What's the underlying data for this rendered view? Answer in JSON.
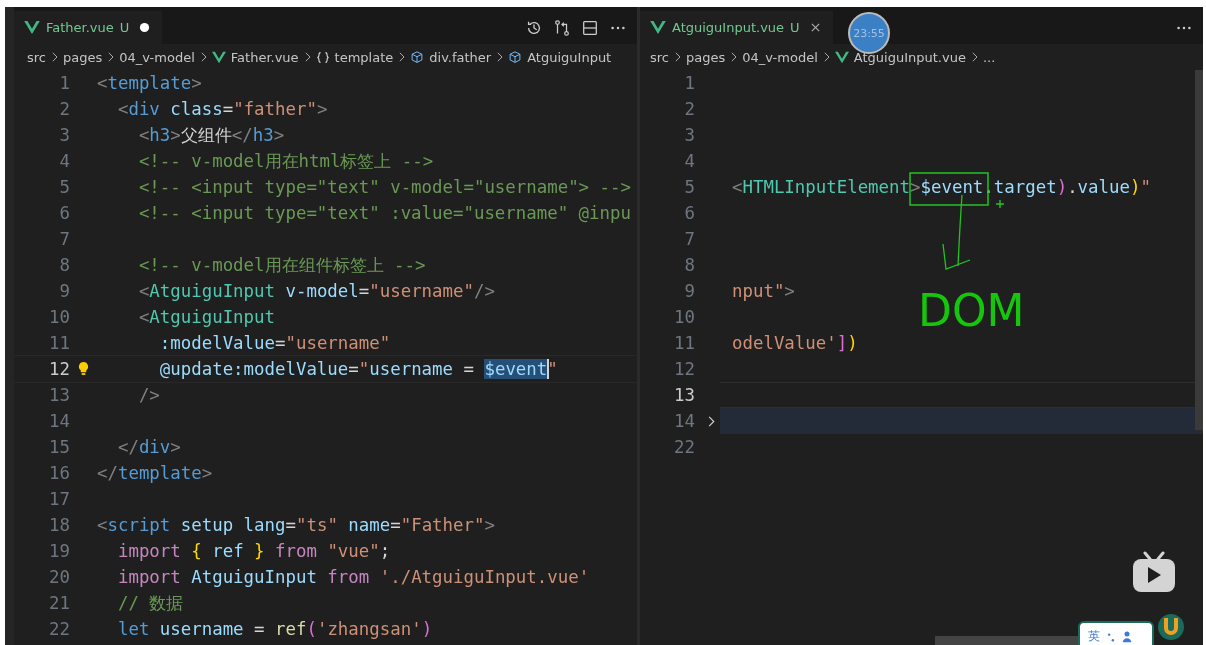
{
  "left_pane": {
    "tab": {
      "name": "Father.vue",
      "status": "U",
      "dirty": true
    },
    "breadcrumb": [
      {
        "text": "src",
        "kind": "folder"
      },
      {
        "text": "pages",
        "kind": "folder"
      },
      {
        "text": "04_v-model",
        "kind": "folder"
      },
      {
        "text": "Father.vue",
        "kind": "vue"
      },
      {
        "text": "template",
        "kind": "braces"
      },
      {
        "text": "div.father",
        "kind": "element"
      },
      {
        "text": "AtguiguInput",
        "kind": "element"
      }
    ],
    "lines": [
      {
        "n": "1",
        "current": false,
        "lightbulb": false,
        "tokens": [
          {
            "t": "<",
            "kind": "punct"
          },
          {
            "t": "template",
            "kind": "tag"
          },
          {
            "t": ">",
            "kind": "punct"
          }
        ]
      },
      {
        "n": "2",
        "current": false,
        "lightbulb": false,
        "tokens": [
          {
            "t": "  <",
            "kind": "punct"
          },
          {
            "t": "div",
            "kind": "tag"
          },
          {
            "t": " class",
            "kind": "attr"
          },
          {
            "t": "=",
            "kind": "plain"
          },
          {
            "t": "\"father\"",
            "kind": "string"
          },
          {
            "t": ">",
            "kind": "punct"
          }
        ]
      },
      {
        "n": "3",
        "current": false,
        "lightbulb": false,
        "tokens": [
          {
            "t": "    <",
            "kind": "punct"
          },
          {
            "t": "h3",
            "kind": "tag"
          },
          {
            "t": ">",
            "kind": "punct"
          },
          {
            "t": "父组件",
            "kind": "plain"
          },
          {
            "t": "</",
            "kind": "punct"
          },
          {
            "t": "h3",
            "kind": "tag"
          },
          {
            "t": ">",
            "kind": "punct"
          }
        ]
      },
      {
        "n": "4",
        "current": false,
        "lightbulb": false,
        "tokens": [
          {
            "t": "    <!-- v-model用在html标签上 -->",
            "kind": "comment"
          }
        ]
      },
      {
        "n": "5",
        "current": false,
        "lightbulb": false,
        "tokens": [
          {
            "t": "    <!-- <input type=\"text\" v-model=\"username\"> -->",
            "kind": "comment"
          }
        ]
      },
      {
        "n": "6",
        "current": false,
        "lightbulb": false,
        "tokens": [
          {
            "t": "    <!-- <input type=\"text\" :value=\"username\" @inpu",
            "kind": "comment"
          }
        ]
      },
      {
        "n": "7",
        "current": false,
        "lightbulb": false
      },
      {
        "n": "8",
        "current": false,
        "lightbulb": false,
        "tokens": [
          {
            "t": "    <!-- v-model用在组件标签上 -->",
            "kind": "comment"
          }
        ]
      },
      {
        "n": "9",
        "current": false,
        "lightbulb": false,
        "tokens": [
          {
            "t": "    <",
            "kind": "punct"
          },
          {
            "t": "AtguiguInput",
            "kind": "type"
          },
          {
            "t": " v-model",
            "kind": "attr"
          },
          {
            "t": "=",
            "kind": "plain"
          },
          {
            "t": "\"username\"",
            "kind": "string"
          },
          {
            "t": "/>",
            "kind": "punct"
          }
        ]
      },
      {
        "n": "10",
        "current": false,
        "lightbulb": false,
        "tokens": [
          {
            "t": "    <",
            "kind": "punct"
          },
          {
            "t": "AtguiguInput",
            "kind": "type"
          }
        ]
      },
      {
        "n": "11",
        "current": false,
        "lightbulb": false,
        "tokens": [
          {
            "t": "      :modelValue",
            "kind": "attr"
          },
          {
            "t": "=",
            "kind": "plain"
          },
          {
            "t": "\"username\"",
            "kind": "string"
          }
        ]
      },
      {
        "n": "12",
        "current": true,
        "lightbulb": true,
        "tokens": [
          {
            "t": "      @update:modelValue",
            "kind": "attr"
          },
          {
            "t": "=",
            "kind": "plain"
          },
          {
            "t": "\"",
            "kind": "string"
          },
          {
            "t": "username",
            "kind": "variable"
          },
          {
            "t": " = ",
            "kind": "plain"
          },
          {
            "t": "$event",
            "kind": "variable",
            "selected": true
          },
          {
            "t": "\"",
            "kind": "string"
          }
        ]
      },
      {
        "n": "13",
        "current": false,
        "lightbulb": false,
        "tokens": [
          {
            "t": "    />",
            "kind": "punct"
          }
        ]
      },
      {
        "n": "14",
        "current": false,
        "lightbulb": false
      },
      {
        "n": "15",
        "current": false,
        "lightbulb": false,
        "tokens": [
          {
            "t": "  </",
            "kind": "punct"
          },
          {
            "t": "div",
            "kind": "tag"
          },
          {
            "t": ">",
            "kind": "punct"
          }
        ]
      },
      {
        "n": "16",
        "current": false,
        "lightbulb": false,
        "tokens": [
          {
            "t": "</",
            "kind": "punct"
          },
          {
            "t": "template",
            "kind": "tag"
          },
          {
            "t": ">",
            "kind": "punct"
          }
        ]
      },
      {
        "n": "17",
        "current": false,
        "lightbulb": false
      },
      {
        "n": "18",
        "current": false,
        "lightbulb": false,
        "tokens": [
          {
            "t": "<",
            "kind": "punct"
          },
          {
            "t": "script",
            "kind": "tag"
          },
          {
            "t": " setup lang",
            "kind": "attr"
          },
          {
            "t": "=",
            "kind": "plain"
          },
          {
            "t": "\"ts\"",
            "kind": "string"
          },
          {
            "t": " name",
            "kind": "attr"
          },
          {
            "t": "=",
            "kind": "plain"
          },
          {
            "t": "\"Father\"",
            "kind": "string"
          },
          {
            "t": ">",
            "kind": "punct"
          }
        ]
      },
      {
        "n": "19",
        "current": false,
        "lightbulb": false,
        "tokens": [
          {
            "t": "  import",
            "kind": "control"
          },
          {
            "t": " {",
            "kind": "bracket"
          },
          {
            "t": " ref",
            "kind": "variable"
          },
          {
            "t": " }",
            "kind": "bracket"
          },
          {
            "t": " from",
            "kind": "control"
          },
          {
            "t": " \"vue\"",
            "kind": "string"
          },
          {
            "t": ";",
            "kind": "plain"
          }
        ]
      },
      {
        "n": "20",
        "current": false,
        "lightbulb": false,
        "tokens": [
          {
            "t": "  import",
            "kind": "control"
          },
          {
            "t": " AtguiguInput",
            "kind": "variable"
          },
          {
            "t": " from",
            "kind": "control"
          },
          {
            "t": " './AtguiguInput.vue'",
            "kind": "string"
          }
        ]
      },
      {
        "n": "21",
        "current": false,
        "lightbulb": false,
        "tokens": [
          {
            "t": "  // 数据",
            "kind": "comment"
          }
        ]
      },
      {
        "n": "22",
        "current": false,
        "lightbulb": false,
        "tokens": [
          {
            "t": "  let",
            "kind": "keyword"
          },
          {
            "t": " username",
            "kind": "variable"
          },
          {
            "t": " = ",
            "kind": "plain"
          },
          {
            "t": "ref",
            "kind": "function"
          },
          {
            "t": "(",
            "kind": "paren"
          },
          {
            "t": "'zhangsan'",
            "kind": "string"
          },
          {
            "t": ")",
            "kind": "paren"
          }
        ]
      }
    ]
  },
  "right_pane": {
    "tab": {
      "name": "AtguiguInput.vue",
      "status": "U",
      "dirty": false
    },
    "breadcrumb": [
      {
        "text": "src",
        "kind": "folder"
      },
      {
        "text": "pages",
        "kind": "folder"
      },
      {
        "text": "04_v-model",
        "kind": "folder"
      },
      {
        "text": "AtguiguInput.vue",
        "kind": "vue"
      },
      {
        "text": "...",
        "kind": "more"
      }
    ],
    "lines": [
      {
        "n": "1",
        "current": false,
        "folded": false
      },
      {
        "n": "2",
        "current": false,
        "folded": false
      },
      {
        "n": "3",
        "current": false,
        "folded": false
      },
      {
        "n": "4",
        "current": false,
        "folded": false
      },
      {
        "n": "5",
        "current": false,
        "folded": false,
        "tokens": [
          {
            "t": "<",
            "kind": "punct"
          },
          {
            "t": "HTMLInputElement",
            "kind": "type"
          },
          {
            "t": ">",
            "kind": "punct"
          },
          {
            "t": "$event",
            "kind": "variable"
          },
          {
            "t": ".",
            "kind": "plain"
          },
          {
            "t": "target",
            "kind": "variable"
          },
          {
            "t": ")",
            "kind": "paren"
          },
          {
            "t": ".",
            "kind": "plain"
          },
          {
            "t": "value",
            "kind": "variable"
          },
          {
            "t": ")",
            "kind": "bracket"
          },
          {
            "t": "\"",
            "kind": "string"
          }
        ]
      },
      {
        "n": "6",
        "current": false,
        "folded": false
      },
      {
        "n": "7",
        "current": false,
        "folded": false
      },
      {
        "n": "8",
        "current": false,
        "folded": false
      },
      {
        "n": "9",
        "current": false,
        "folded": false,
        "tokens": [
          {
            "t": "nput\"",
            "kind": "string"
          },
          {
            "t": ">",
            "kind": "punct"
          }
        ]
      },
      {
        "n": "10",
        "current": false,
        "folded": false
      },
      {
        "n": "11",
        "current": false,
        "folded": false,
        "tokens": [
          {
            "t": "odelValue'",
            "kind": "string"
          },
          {
            "t": "]",
            "kind": "paren"
          },
          {
            "t": ")",
            "kind": "bracket"
          }
        ]
      },
      {
        "n": "12",
        "current": false,
        "folded": false
      },
      {
        "n": "13",
        "current": true,
        "folded": false
      },
      {
        "n": "14",
        "current": false,
        "folded": true
      },
      {
        "n": "22",
        "current": false,
        "folded": false
      }
    ]
  },
  "annotation": {
    "text": "DOM"
  },
  "timer": "23:55",
  "ime": {
    "label": "英"
  }
}
